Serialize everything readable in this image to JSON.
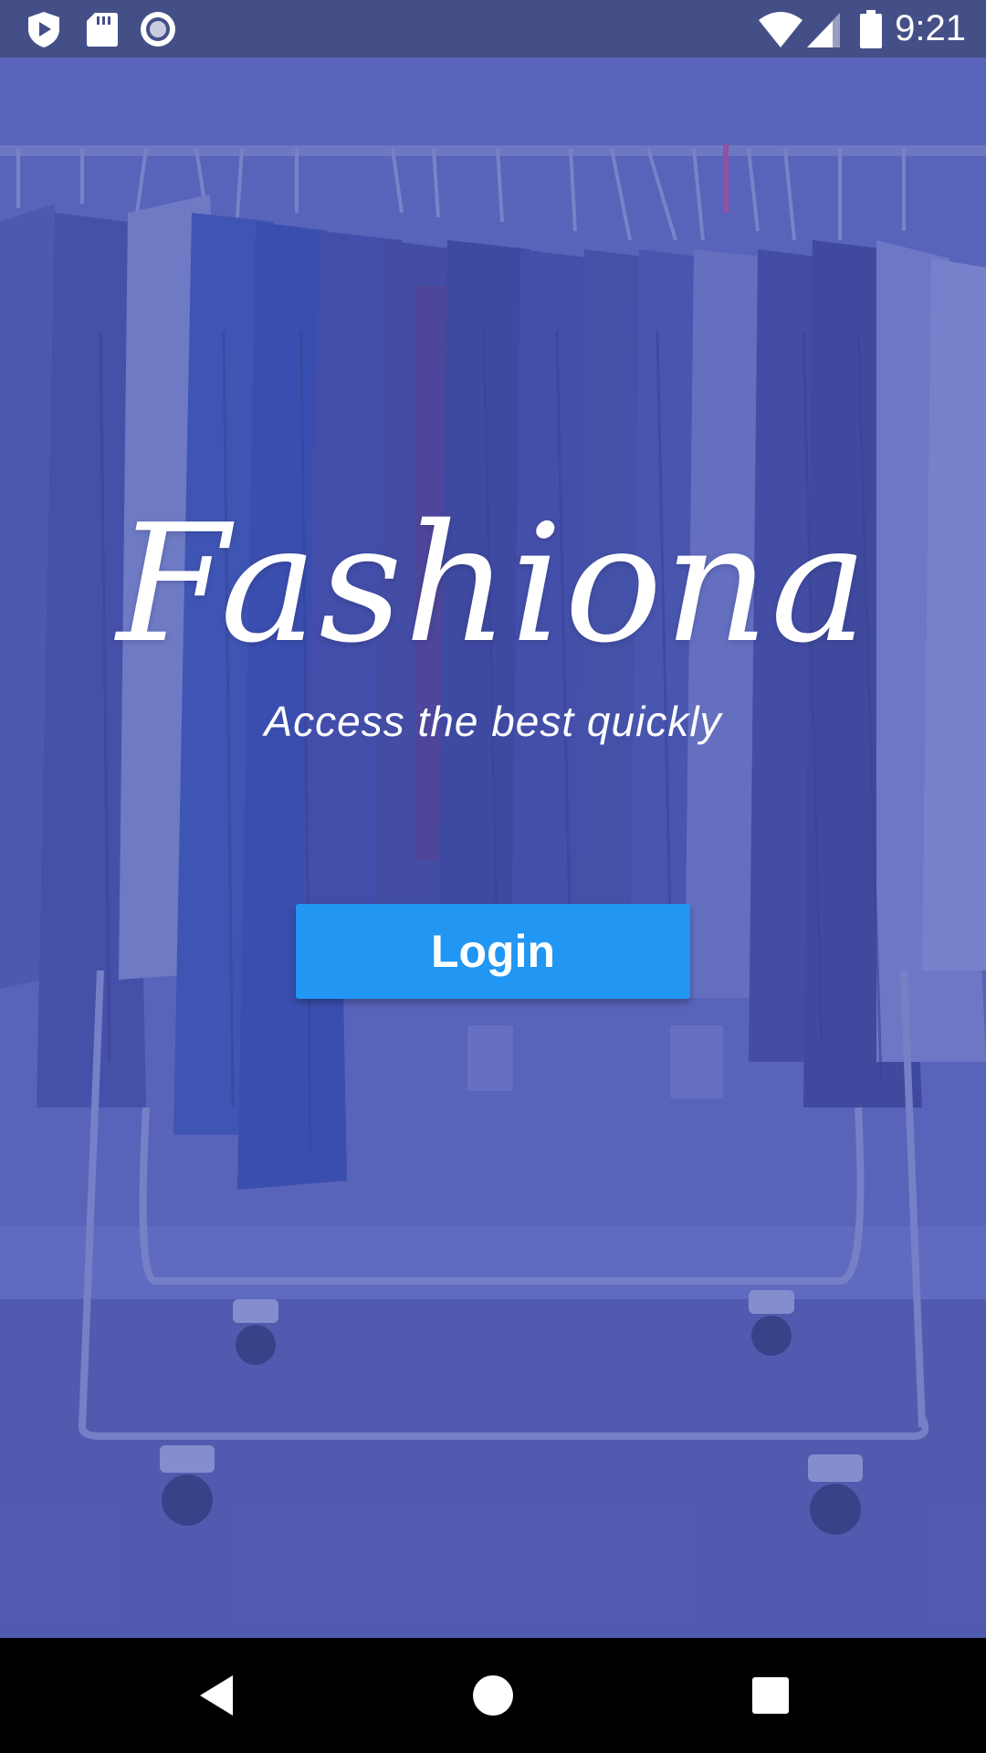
{
  "status_bar": {
    "time": "9:21",
    "left_icons": [
      "shield-play-icon",
      "sd-card-icon",
      "record-circle-icon"
    ],
    "right_icons": [
      "wifi-icon",
      "cell-signal-icon",
      "battery-icon"
    ]
  },
  "hero": {
    "background": "clothing-rack-photo",
    "overlay_color": "#5d67b9"
  },
  "app": {
    "title": "Fashiona",
    "tagline": "Access the best quickly"
  },
  "actions": {
    "login_label": "Login",
    "login_color": "#2196f3"
  },
  "nav_bar": {
    "buttons": [
      "back-icon",
      "home-icon",
      "recents-icon"
    ]
  }
}
